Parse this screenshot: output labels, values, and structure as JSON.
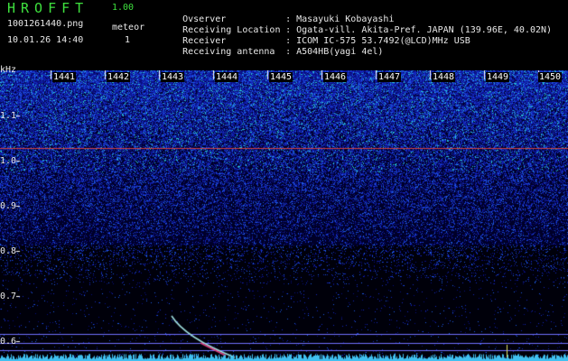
{
  "header": {
    "logo": "HROFFT",
    "version": "1.00",
    "filename": "1001261440.png",
    "datetime": "10.01.26 14:40",
    "meteor_label": "meteor",
    "meteor_count": "1"
  },
  "info": [
    {
      "key": "Ovserver",
      "value": "Masayuki Kobayashi"
    },
    {
      "key": "Receiving Location",
      "value": "Ogata-vill. Akita-Pref. JAPAN (139.96E, 40.02N)"
    },
    {
      "key": "Receiver",
      "value": "ICOM IC-575 53.7492(@LCD)MHz USB"
    },
    {
      "key": "Receiving antenna",
      "value": "A504HB(yagi 4el)"
    }
  ],
  "axis": {
    "unit": "kHz",
    "time_labels": [
      "1441",
      "1442",
      "1443",
      "1444",
      "1445",
      "1446",
      "1447",
      "1448",
      "1449",
      "1450"
    ],
    "freq_labels": [
      "1.1",
      "1.0",
      "0.9",
      "0.8",
      "0.7",
      "0.6"
    ]
  },
  "colors": {
    "text": "#e8e8e8",
    "logo": "#3ee03e",
    "bg": "#000000",
    "reference_line": "#d04040",
    "guide_line": "#7070ff"
  }
}
